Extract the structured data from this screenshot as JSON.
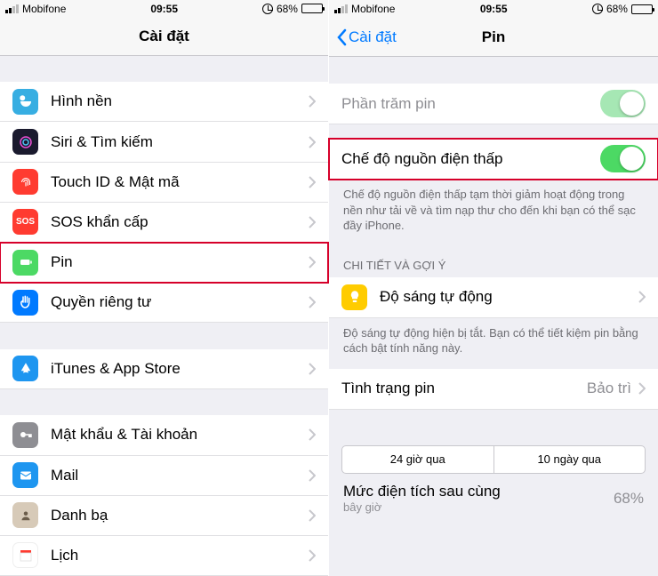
{
  "status": {
    "carrier": "Mobifone",
    "time": "09:55",
    "battery_pct": "68%"
  },
  "left": {
    "title": "Cài đặt",
    "items": {
      "wallpaper": "Hình nền",
      "siri": "Siri & Tìm kiếm",
      "touchid": "Touch ID & Mật mã",
      "sos": "SOS khẩn cấp",
      "battery": "Pin",
      "privacy": "Quyền riêng tư",
      "itunes": "iTunes & App Store",
      "passwords": "Mật khẩu & Tài khoản",
      "mail": "Mail",
      "contacts": "Danh bạ",
      "calendar": "Lịch"
    }
  },
  "right": {
    "back": "Cài đặt",
    "title": "Pin",
    "pct_label": "Phần trăm pin",
    "lpm_label": "Chế độ nguồn điện thấp",
    "lpm_hint": "Chế độ nguồn điện thấp tạm thời giảm hoạt động trong nền như tải về và tìm nạp thư cho đến khi bạn có thể sạc đầy iPhone.",
    "section_header": "CHI TIẾT VÀ GỢI Ý",
    "auto_bright": "Độ sáng tự động",
    "auto_bright_hint": "Độ sáng tự động hiện bị tắt. Bạn có thể tiết kiệm pin bằng cách bật tính năng này.",
    "health": "Tình trạng pin",
    "health_val": "Bảo trì",
    "seg_24h": "24 giờ qua",
    "seg_10d": "10 ngày qua",
    "last_charge": "Mức điện tích sau cùng",
    "last_charge_time": "bây giờ",
    "last_charge_val": "68%"
  },
  "sos_text": "SOS"
}
